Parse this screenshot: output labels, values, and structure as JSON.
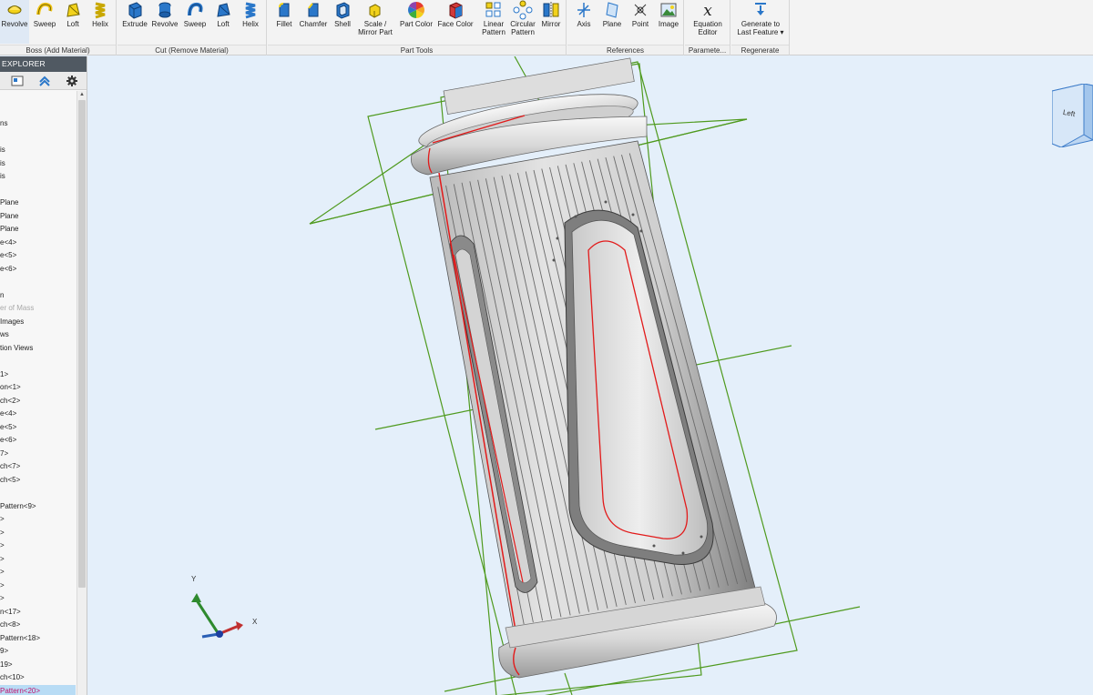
{
  "ribbon": {
    "groups": [
      {
        "label": "Boss (Add Material)",
        "tools": [
          "Revolve",
          "Sweep",
          "Loft",
          "Helix"
        ]
      },
      {
        "label": "Cut (Remove Material)",
        "tools": [
          "Extrude",
          "Revolve",
          "Sweep",
          "Loft",
          "Helix"
        ]
      },
      {
        "label": "Part Tools",
        "tools": [
          "Fillet",
          "Chamfer",
          "Shell",
          "Scale /\nMirror Part",
          "Part Color",
          "Face Color",
          "Linear\nPattern",
          "Circular\nPattern",
          "Mirror"
        ]
      },
      {
        "label": "References",
        "tools": [
          "Axis",
          "Plane",
          "Point",
          "Image"
        ]
      },
      {
        "label": "Paramete...",
        "tools": [
          "Equation\nEditor"
        ]
      },
      {
        "label": "Regenerate",
        "tools": [
          "Generate to\nLast Feature ▾"
        ]
      }
    ]
  },
  "explorer": {
    "title": "EXPLORER",
    "items": [
      {
        "text": "",
        "style": ""
      },
      {
        "text": "",
        "style": ""
      },
      {
        "text": "ns",
        "style": ""
      },
      {
        "text": "",
        "style": ""
      },
      {
        "text": "is",
        "style": ""
      },
      {
        "text": "is",
        "style": ""
      },
      {
        "text": "is",
        "style": ""
      },
      {
        "text": "",
        "style": ""
      },
      {
        "text": "Plane",
        "style": ""
      },
      {
        "text": "Plane",
        "style": ""
      },
      {
        "text": "Plane",
        "style": ""
      },
      {
        "text": "e<4>",
        "style": ""
      },
      {
        "text": "e<5>",
        "style": ""
      },
      {
        "text": "e<6>",
        "style": ""
      },
      {
        "text": "",
        "style": ""
      },
      {
        "text": "n",
        "style": ""
      },
      {
        "text": "er of Mass",
        "style": "dim"
      },
      {
        "text": "Images",
        "style": ""
      },
      {
        "text": "ws",
        "style": ""
      },
      {
        "text": "tion Views",
        "style": ""
      },
      {
        "text": "",
        "style": ""
      },
      {
        "text": "1>",
        "style": ""
      },
      {
        "text": "on<1>",
        "style": ""
      },
      {
        "text": "ch<2>",
        "style": ""
      },
      {
        "text": "e<4>",
        "style": ""
      },
      {
        "text": "e<5>",
        "style": ""
      },
      {
        "text": "e<6>",
        "style": ""
      },
      {
        "text": "7>",
        "style": ""
      },
      {
        "text": "ch<7>",
        "style": ""
      },
      {
        "text": "ch<5>",
        "style": ""
      },
      {
        "text": "",
        "style": ""
      },
      {
        "text": "Pattern<9>",
        "style": ""
      },
      {
        "text": ">",
        "style": ""
      },
      {
        "text": ">",
        "style": ""
      },
      {
        "text": ">",
        "style": ""
      },
      {
        "text": ">",
        "style": ""
      },
      {
        "text": ">",
        "style": ""
      },
      {
        "text": ">",
        "style": ""
      },
      {
        "text": ">",
        "style": ""
      },
      {
        "text": "n<17>",
        "style": ""
      },
      {
        "text": "ch<8>",
        "style": ""
      },
      {
        "text": "Pattern<18>",
        "style": ""
      },
      {
        "text": "9>",
        "style": ""
      },
      {
        "text": "19>",
        "style": ""
      },
      {
        "text": "ch<10>",
        "style": ""
      },
      {
        "text": "Pattern<20>",
        "style": "sel"
      }
    ]
  },
  "viewport": {
    "triad": {
      "x": "X",
      "y": "Y"
    },
    "view_cube_face": "Left"
  },
  "colors": {
    "ribbon_bg": "#f3f3f3",
    "viewport_bg": "#e4effa",
    "plane_outline": "#4f9a1e",
    "edge_highlight": "#e21a1a",
    "selected_item": "#c0136e"
  }
}
